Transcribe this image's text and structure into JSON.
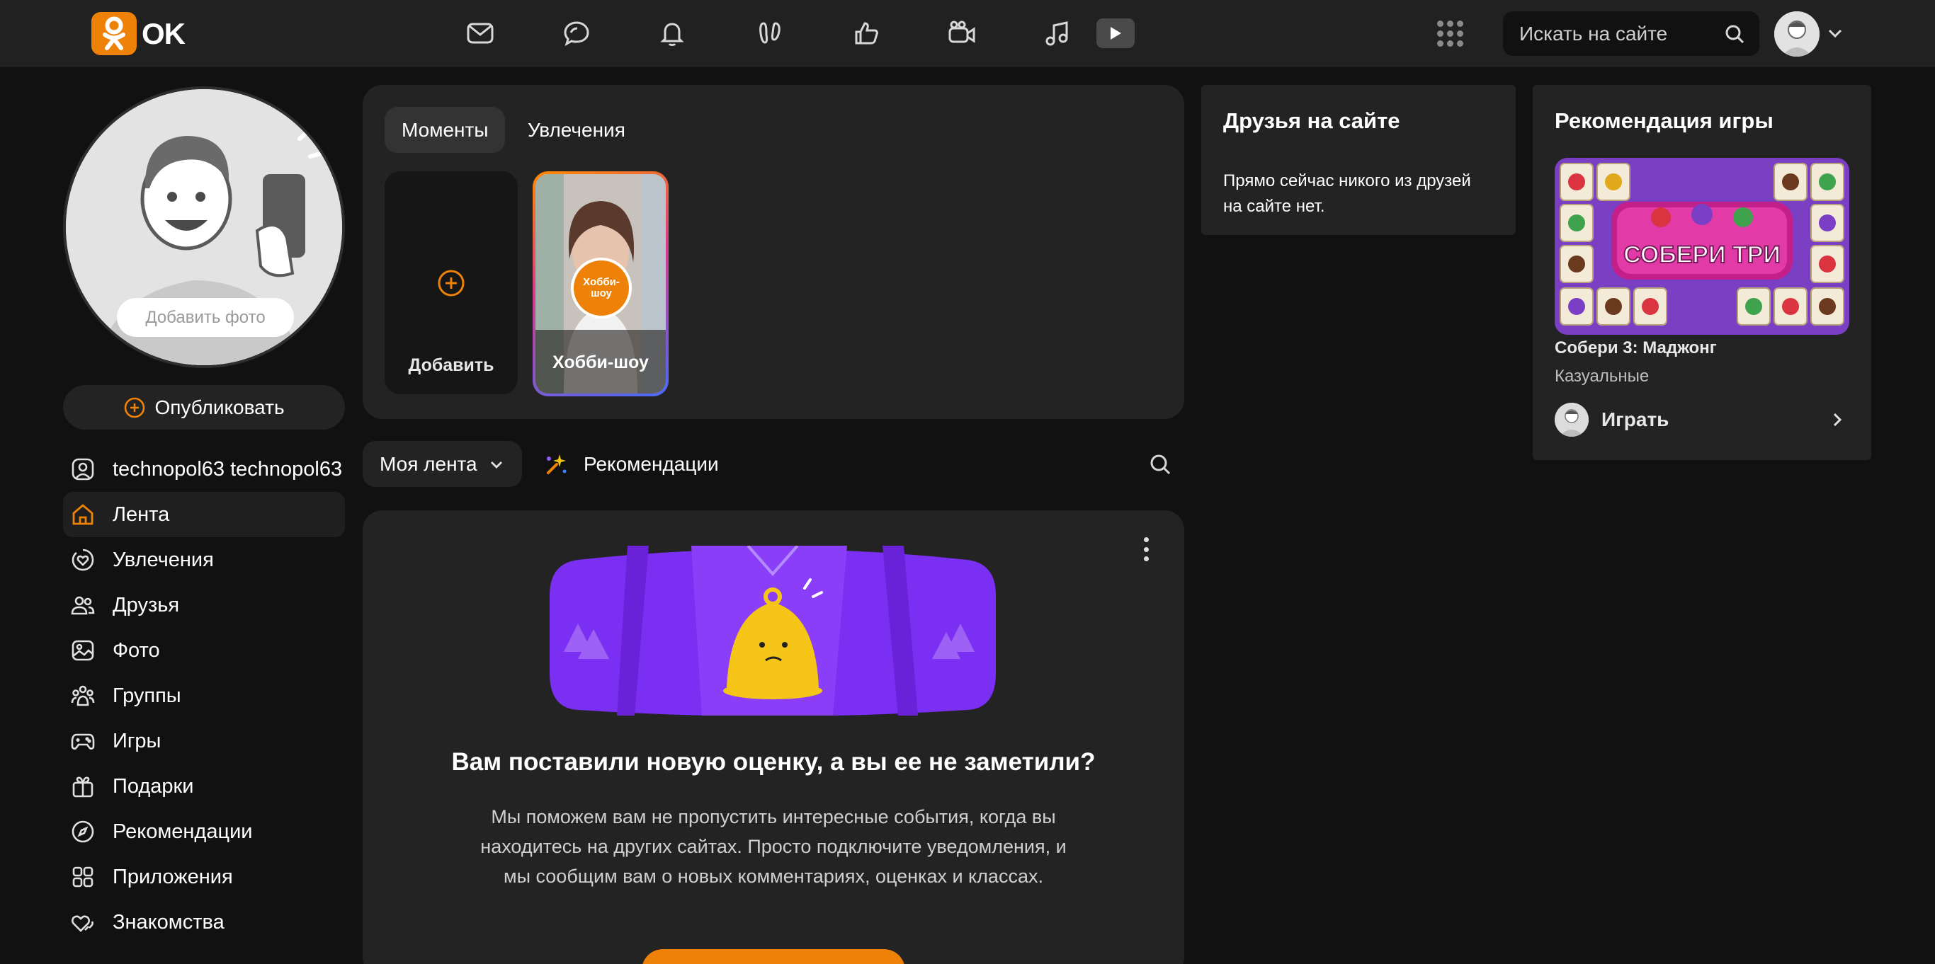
{
  "brand": {
    "name": "OK",
    "accent": "#ee8208"
  },
  "topbar": {
    "nav_icons": [
      "messages-icon",
      "discussions-icon",
      "notifications-icon",
      "guests-icon",
      "likes-icon",
      "video-calls-icon",
      "music-icon",
      "video-icon"
    ],
    "search_placeholder": "Искать на сайте"
  },
  "profile": {
    "add_photo_label": "Добавить фото",
    "publish_label": "Опубликовать"
  },
  "sidebar": {
    "items": [
      {
        "label": "technopol63 technopol63",
        "icon": "user-icon"
      },
      {
        "label": "Лента",
        "icon": "home-icon",
        "active": true
      },
      {
        "label": "Увлечения",
        "icon": "hobbies-icon"
      },
      {
        "label": "Друзья",
        "icon": "friends-icon"
      },
      {
        "label": "Фото",
        "icon": "photo-icon"
      },
      {
        "label": "Группы",
        "icon": "groups-icon"
      },
      {
        "label": "Игры",
        "icon": "gamepad-icon"
      },
      {
        "label": "Подарки",
        "icon": "gift-icon"
      },
      {
        "label": "Рекомендации",
        "icon": "compass-icon"
      },
      {
        "label": "Приложения",
        "icon": "apps-icon"
      },
      {
        "label": "Знакомства",
        "icon": "dating-icon"
      }
    ]
  },
  "moments": {
    "tabs": [
      "Моменты",
      "Увлечения"
    ],
    "active_tab": "Моменты",
    "add_label": "Добавить",
    "story": {
      "badge": "Хобби-шоу",
      "label": "Хобби-шоу"
    }
  },
  "feed": {
    "filter_label": "Моя лента",
    "recommendations_label": "Рекомендации"
  },
  "notification": {
    "title": "Вам поставили новую оценку, а вы ее не заметили?",
    "text": "Мы поможем вам не пропустить интересные события, когда вы находитесь на других сайтах. Просто подключите уведомления, и мы сообщим вам о новых комментариях, оценках и классах."
  },
  "friends_online": {
    "title": "Друзья на сайте",
    "text": "Прямо сейчас никого из друзей на сайте нет."
  },
  "game_recommendation": {
    "title": "Рекомендация игры",
    "image_caption": "СОБЕРИ ТРИ",
    "game_name": "Собери 3: Маджонг",
    "genre": "Казуальные",
    "play_label": "Играть"
  }
}
